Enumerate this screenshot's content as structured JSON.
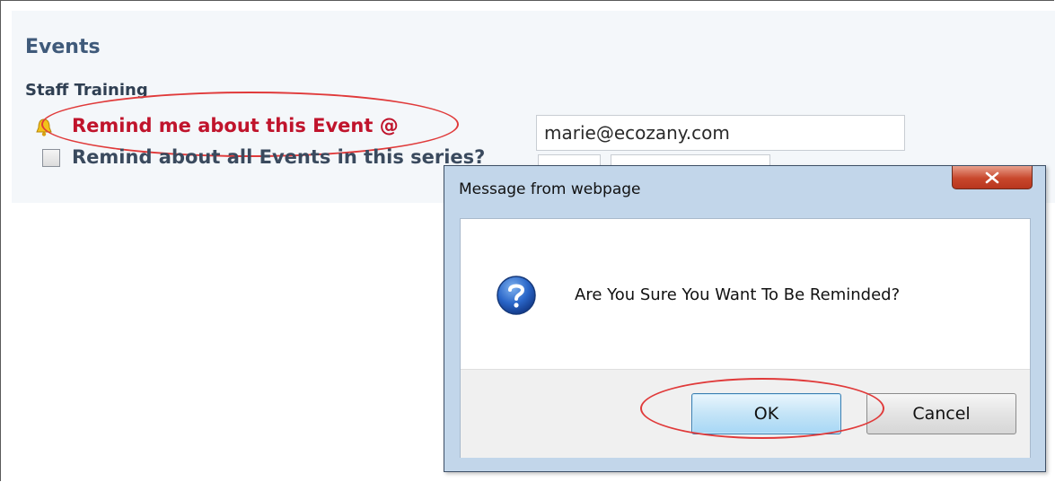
{
  "page": {
    "section_title": "Events",
    "event_name": "Staff Training",
    "remind_link": "Remind me about this Event @",
    "email_value": "marie@ecozany.com",
    "series_checkbox_checked": false,
    "series_label": "Remind about all Events in this series?"
  },
  "dialog": {
    "title": "Message from webpage",
    "close_icon": "close-icon",
    "question_icon": "question-icon",
    "message": "Are You Sure You Want To Be Reminded?",
    "ok_label": "OK",
    "cancel_label": "Cancel"
  },
  "colors": {
    "highlight_oval": "#e03a3a",
    "remind_link": "#c0142c",
    "dialog_frame": "#c2d6ea"
  }
}
